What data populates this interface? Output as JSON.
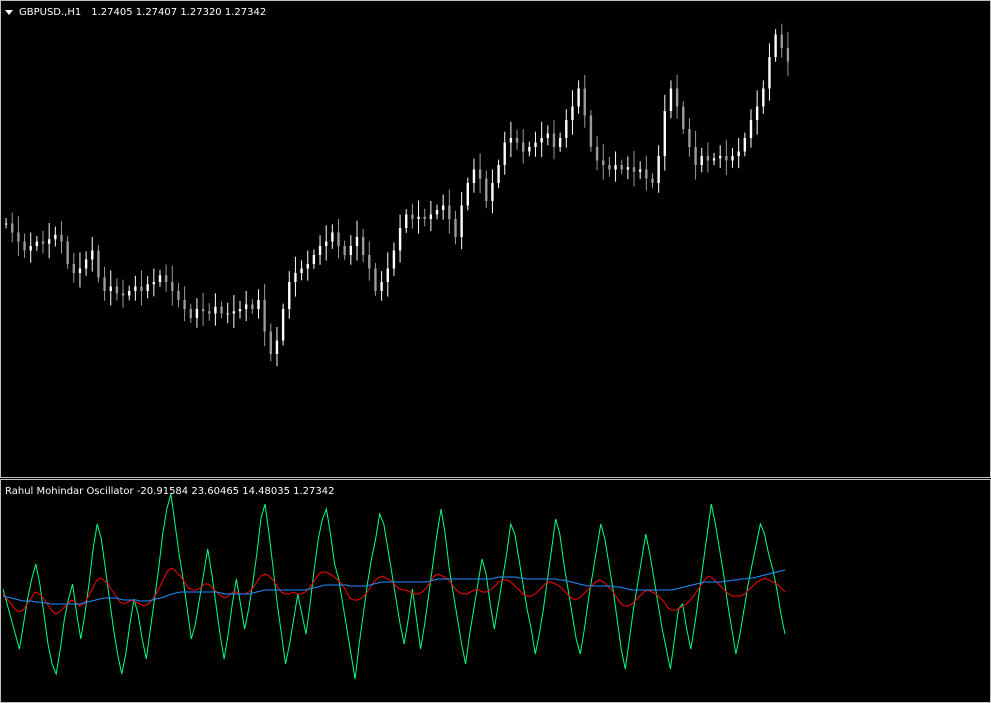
{
  "price_pane": {
    "symbol_tf": "GBPUSD.,H1",
    "ohlc": "1.27405 1.27407 1.27320 1.27342",
    "candle_color": "#ffffff",
    "collapse_icon": "triangle-down-icon"
  },
  "osc_pane": {
    "title": "Rahul Mohindar Oscillator -20.91584 23.60465 14.48035 1.27342",
    "colors": {
      "green": "#00ff7f",
      "red": "#ff0000",
      "blue": "#1e90ff"
    }
  },
  "chart_data": [
    {
      "type": "candlestick",
      "ylim": [
        1.26,
        1.28
      ],
      "closes": [
        1.271,
        1.2706,
        1.2702,
        1.2698,
        1.27,
        1.2702,
        1.2701,
        1.2703,
        1.2705,
        1.2702,
        1.2692,
        1.2688,
        1.269,
        1.2694,
        1.2698,
        1.2686,
        1.268,
        1.2682,
        1.2679,
        1.2678,
        1.268,
        1.2682,
        1.268,
        1.2683,
        1.2684,
        1.2687,
        1.2684,
        1.268,
        1.2676,
        1.2672,
        1.2668,
        1.2672,
        1.2671,
        1.267,
        1.2673,
        1.267,
        1.267,
        1.2671,
        1.2672,
        1.2674,
        1.2672,
        1.2676,
        1.2662,
        1.2652,
        1.2658,
        1.2672,
        1.2684,
        1.2688,
        1.269,
        1.2692,
        1.2696,
        1.27,
        1.2702,
        1.2706,
        1.27,
        1.2696,
        1.27,
        1.2704,
        1.2696,
        1.269,
        1.268,
        1.2684,
        1.269,
        1.2698,
        1.2708,
        1.2714,
        1.2712,
        1.2713,
        1.2712,
        1.2714,
        1.2716,
        1.2718,
        1.2712,
        1.2704,
        1.2718,
        1.2728,
        1.2734,
        1.273,
        1.272,
        1.2728,
        1.2736,
        1.2746,
        1.2748,
        1.2746,
        1.2742,
        1.2744,
        1.2746,
        1.2748,
        1.275,
        1.2744,
        1.2748,
        1.2756,
        1.2762,
        1.277,
        1.2758,
        1.2744,
        1.2738,
        1.2736,
        1.2734,
        1.2736,
        1.2734,
        1.2735,
        1.2733,
        1.2734,
        1.273,
        1.2728,
        1.274,
        1.276,
        1.277,
        1.2762,
        1.2752,
        1.2744,
        1.2736,
        1.274,
        1.2738,
        1.2739,
        1.274,
        1.2738,
        1.274,
        1.2742,
        1.2748,
        1.2756,
        1.2762,
        1.277,
        1.2784,
        1.2794,
        1.2788,
        1.2782
      ]
    },
    {
      "type": "line",
      "series": [
        {
          "color": "#00ff7f",
          "values": [
            5,
            -10,
            -25,
            -40,
            -55,
            -30,
            -5,
            15,
            30,
            10,
            -20,
            -50,
            -70,
            -80,
            -55,
            -25,
            -5,
            10,
            -20,
            -45,
            -20,
            10,
            45,
            70,
            55,
            25,
            -5,
            -35,
            -60,
            -80,
            -60,
            -30,
            -5,
            -20,
            -45,
            -65,
            -35,
            -5,
            25,
            60,
            85,
            100,
            70,
            40,
            15,
            -15,
            -45,
            -30,
            -5,
            20,
            45,
            20,
            -10,
            -40,
            -65,
            -40,
            -10,
            15,
            -10,
            -35,
            -15,
            10,
            40,
            75,
            90,
            60,
            25,
            -10,
            -40,
            -70,
            -50,
            -25,
            0,
            -20,
            -40,
            -10,
            25,
            55,
            75,
            85,
            60,
            30,
            15,
            -10,
            -35,
            -60,
            -85,
            -50,
            -20,
            10,
            35,
            55,
            80,
            70,
            45,
            20,
            -5,
            -30,
            -50,
            -25,
            5,
            -25,
            -55,
            -30,
            0,
            30,
            60,
            85,
            60,
            25,
            0,
            -25,
            -50,
            -70,
            -40,
            -15,
            10,
            35,
            20,
            -10,
            -35,
            -10,
            15,
            40,
            70,
            60,
            35,
            10,
            -15,
            -35,
            -60,
            -40,
            -15,
            15,
            45,
            75,
            60,
            30,
            5,
            -20,
            -45,
            -60,
            -35,
            -5,
            20,
            45,
            70,
            55,
            30,
            5,
            -25,
            -55,
            -75,
            -45,
            -15,
            10,
            35,
            60,
            40,
            15,
            -10,
            -35,
            -55,
            -75,
            -45,
            -15,
            -10,
            -35,
            -55,
            -30,
            0,
            30,
            60,
            90,
            70,
            45,
            20,
            -10,
            -35,
            -60,
            -40,
            -15,
            10,
            30,
            50,
            70,
            60,
            40,
            25,
            5,
            -20,
            -40
          ]
        },
        {
          "color": "#ff0000",
          "values": [
            0,
            -5,
            -10,
            -15,
            -18,
            -16,
            -10,
            -4,
            2,
            0,
            -4,
            -10,
            -16,
            -20,
            -18,
            -14,
            -10,
            -6,
            -8,
            -12,
            -10,
            -4,
            4,
            12,
            16,
            14,
            10,
            4,
            -2,
            -8,
            -10,
            -8,
            -6,
            -8,
            -10,
            -12,
            -10,
            -6,
            0,
            8,
            16,
            24,
            26,
            22,
            18,
            12,
            6,
            4,
            4,
            6,
            10,
            10,
            6,
            2,
            -2,
            -4,
            -2,
            2,
            2,
            0,
            0,
            2,
            6,
            12,
            18,
            20,
            18,
            14,
            8,
            2,
            0,
            0,
            2,
            0,
            0,
            2,
            6,
            12,
            18,
            22,
            22,
            20,
            18,
            14,
            10,
            4,
            -4,
            -6,
            -6,
            -4,
            0,
            6,
            12,
            16,
            18,
            16,
            14,
            10,
            6,
            4,
            4,
            2,
            0,
            0,
            2,
            6,
            12,
            18,
            20,
            18,
            16,
            12,
            6,
            2,
            0,
            0,
            2,
            4,
            4,
            2,
            2,
            4,
            8,
            12,
            14,
            14,
            12,
            8,
            4,
            0,
            -2,
            -2,
            0,
            4,
            8,
            12,
            12,
            10,
            8,
            4,
            0,
            -4,
            -6,
            -4,
            0,
            4,
            8,
            12,
            14,
            12,
            8,
            4,
            -2,
            -8,
            -12,
            -12,
            -10,
            -6,
            -2,
            2,
            4,
            2,
            0,
            -4,
            -8,
            -14,
            -16,
            -16,
            -14,
            -12,
            -8,
            -4,
            2,
            8,
            14,
            18,
            16,
            12,
            8,
            4,
            0,
            -2,
            -2,
            -2,
            0,
            4,
            8,
            12,
            14,
            16,
            14,
            12,
            10,
            6,
            2
          ]
        },
        {
          "color": "#1e90ff",
          "values": [
            -2,
            -3,
            -4,
            -5,
            -6,
            -7,
            -7,
            -7,
            -8,
            -8,
            -9,
            -9,
            -10,
            -10,
            -10,
            -10,
            -10,
            -10,
            -10,
            -10,
            -9,
            -8,
            -7,
            -6,
            -5,
            -4,
            -4,
            -4,
            -4,
            -5,
            -6,
            -6,
            -6,
            -6,
            -7,
            -7,
            -7,
            -6,
            -5,
            -4,
            -3,
            -1,
            0,
            1,
            2,
            2,
            2,
            2,
            2,
            2,
            2,
            2,
            2,
            2,
            1,
            0,
            0,
            0,
            0,
            0,
            0,
            0,
            1,
            2,
            3,
            4,
            4,
            4,
            4,
            4,
            4,
            4,
            4,
            4,
            4,
            4,
            5,
            6,
            7,
            8,
            9,
            9,
            9,
            9,
            9,
            9,
            8,
            8,
            8,
            8,
            8,
            9,
            10,
            11,
            12,
            12,
            12,
            12,
            12,
            12,
            12,
            12,
            12,
            12,
            12,
            12,
            13,
            14,
            15,
            15,
            15,
            15,
            15,
            15,
            15,
            15,
            15,
            15,
            15,
            15,
            15,
            15,
            16,
            17,
            17,
            17,
            17,
            17,
            16,
            16,
            15,
            15,
            15,
            15,
            15,
            15,
            15,
            15,
            14,
            14,
            13,
            12,
            11,
            10,
            9,
            8,
            8,
            8,
            8,
            8,
            8,
            8,
            7,
            7,
            6,
            5,
            4,
            4,
            4,
            4,
            4,
            4,
            4,
            4,
            4,
            4,
            4,
            5,
            6,
            7,
            8,
            9,
            10,
            11,
            12,
            12,
            12,
            12,
            12,
            13,
            13,
            14,
            14,
            15,
            15,
            16,
            16,
            17,
            18,
            19,
            20,
            21,
            22,
            23,
            24
          ]
        }
      ],
      "ylim": [
        -100,
        100
      ]
    }
  ]
}
